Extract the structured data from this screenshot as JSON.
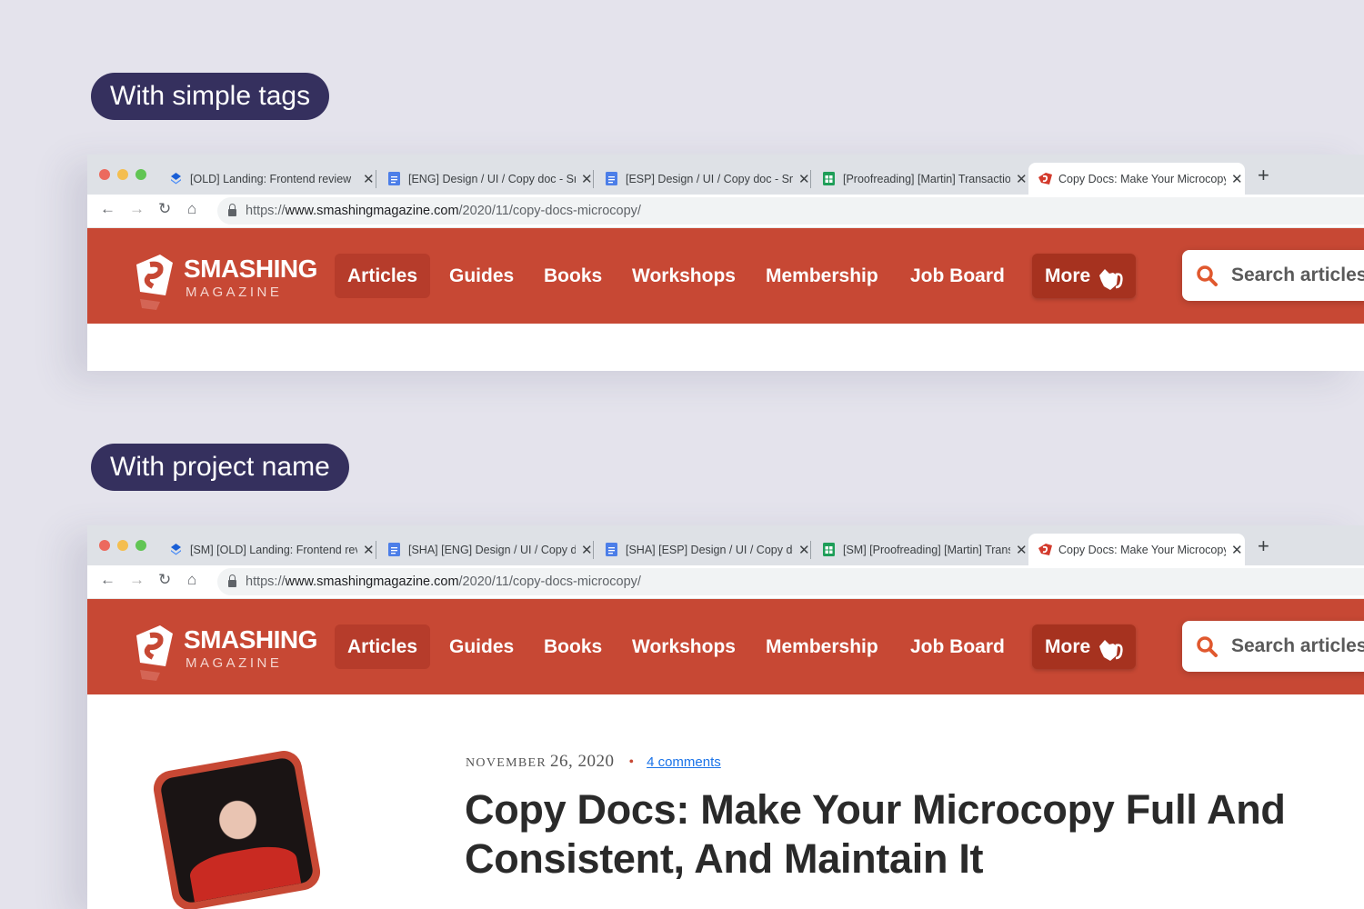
{
  "sections": [
    {
      "label": "With simple tags",
      "browser": {
        "tabs": [
          {
            "title": "[OLD] Landing: Frontend review",
            "icon": "dropbox-paper-icon"
          },
          {
            "title": "[ENG] Design / UI / Copy doc - Smashing",
            "icon": "google-docs-icon"
          },
          {
            "title": "[ESP] Design / UI / Copy doc - Smashing",
            "icon": "google-docs-icon"
          },
          {
            "title": "[Proofreading] [Martin] Transactions",
            "icon": "google-sheets-icon"
          },
          {
            "title": "Copy Docs: Make Your Microcopy",
            "icon": "smashing-icon"
          }
        ],
        "url_prefix": "https://",
        "url_domain": "www.smashingmagazine.com",
        "url_path": "/2020/11/copy-docs-microcopy/"
      }
    },
    {
      "label": "With project name",
      "browser": {
        "tabs": [
          {
            "title": "[SM] [OLD] Landing: Frontend review",
            "icon": "dropbox-paper-icon"
          },
          {
            "title": "[SHA] [ENG] Design / UI / Copy doc",
            "icon": "google-docs-icon"
          },
          {
            "title": "[SHA] [ESP] Design / UI / Copy doc",
            "icon": "google-docs-icon"
          },
          {
            "title": "[SM] [Proofreading] [Martin] Transactions",
            "icon": "google-sheets-icon"
          },
          {
            "title": "Copy Docs: Make Your Microcopy",
            "icon": "smashing-icon"
          }
        ],
        "url_prefix": "https://",
        "url_domain": "www.smashingmagazine.com",
        "url_path": "/2020/11/copy-docs-microcopy/"
      }
    }
  ],
  "site": {
    "logo_title": "SMASHING",
    "logo_subtitle": "MAGAZINE",
    "nav": [
      "Articles",
      "Guides",
      "Books",
      "Workshops",
      "Membership",
      "Job Board",
      "More"
    ],
    "search_placeholder": "Search articles...",
    "brand_color": "#c74834"
  },
  "article": {
    "date_month": "NOVEMBER",
    "date_day": "26, 2020",
    "comments": "4 comments",
    "title": "Copy Docs: Make Your Microcopy Full And Consistent, And Maintain It"
  }
}
